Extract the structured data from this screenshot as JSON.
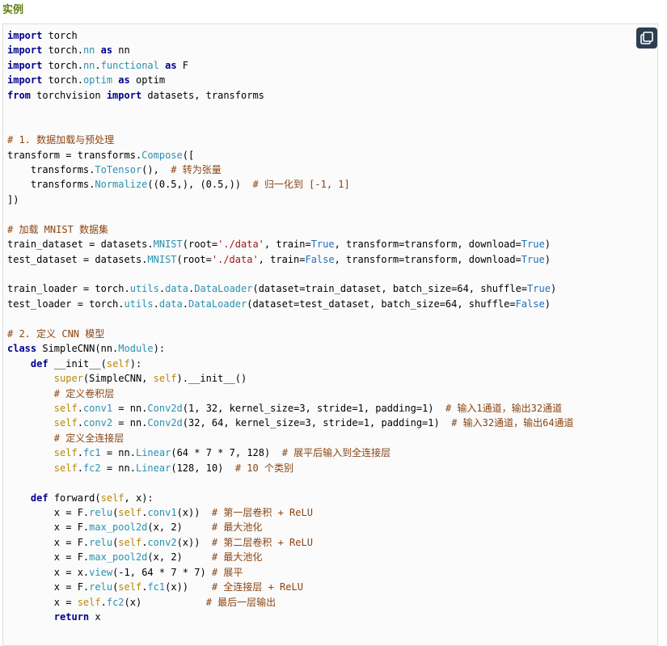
{
  "heading": "实例",
  "copy_button": {
    "icon": "copy-icon",
    "color": "#2d3e50"
  },
  "colors": {
    "heading": "#617f10",
    "keyword": "#00008b",
    "attribute": "#2b91af",
    "string": "#a31515",
    "constant": "#1e6fbf",
    "comment": "#8b4513",
    "self": "#b8860b"
  },
  "code_lines": [
    [
      [
        "kw",
        "import"
      ],
      [
        "plain",
        " torch"
      ]
    ],
    [
      [
        "kw",
        "import"
      ],
      [
        "plain",
        " torch."
      ],
      [
        "attr",
        "nn"
      ],
      [
        "plain",
        " "
      ],
      [
        "kw",
        "as"
      ],
      [
        "plain",
        " nn"
      ]
    ],
    [
      [
        "kw",
        "import"
      ],
      [
        "plain",
        " torch."
      ],
      [
        "attr",
        "nn"
      ],
      [
        "plain",
        "."
      ],
      [
        "attr",
        "functional"
      ],
      [
        "plain",
        " "
      ],
      [
        "kw",
        "as"
      ],
      [
        "plain",
        " F"
      ]
    ],
    [
      [
        "kw",
        "import"
      ],
      [
        "plain",
        " torch."
      ],
      [
        "attr",
        "optim"
      ],
      [
        "plain",
        " "
      ],
      [
        "kw",
        "as"
      ],
      [
        "plain",
        " optim"
      ]
    ],
    [
      [
        "kw",
        "from"
      ],
      [
        "plain",
        " torchvision "
      ],
      [
        "kw",
        "import"
      ],
      [
        "plain",
        " datasets, transforms"
      ]
    ],
    [],
    [],
    [
      [
        "com",
        "# 1. 数据加载与预处理"
      ]
    ],
    [
      [
        "plain",
        "transform = transforms."
      ],
      [
        "attr",
        "Compose"
      ],
      [
        "plain",
        "(["
      ]
    ],
    [
      [
        "plain",
        "    transforms."
      ],
      [
        "attr",
        "ToTensor"
      ],
      [
        "plain",
        "(),  "
      ],
      [
        "com",
        "# 转为张量"
      ]
    ],
    [
      [
        "plain",
        "    transforms."
      ],
      [
        "attr",
        "Normalize"
      ],
      [
        "plain",
        "(("
      ],
      [
        "num",
        "0.5"
      ],
      [
        "plain",
        ",), ("
      ],
      [
        "num",
        "0.5"
      ],
      [
        "plain",
        ",))  "
      ],
      [
        "com",
        "# 归一化到 [-1, 1]"
      ]
    ],
    [
      [
        "plain",
        "])"
      ]
    ],
    [],
    [
      [
        "com",
        "# 加载 MNIST 数据集"
      ]
    ],
    [
      [
        "plain",
        "train_dataset = datasets."
      ],
      [
        "attr",
        "MNIST"
      ],
      [
        "plain",
        "(root="
      ],
      [
        "str",
        "'./data'"
      ],
      [
        "plain",
        ", train="
      ],
      [
        "const",
        "True"
      ],
      [
        "plain",
        ", transform=transform, download="
      ],
      [
        "const",
        "True"
      ],
      [
        "plain",
        ")"
      ]
    ],
    [
      [
        "plain",
        "test_dataset = datasets."
      ],
      [
        "attr",
        "MNIST"
      ],
      [
        "plain",
        "(root="
      ],
      [
        "str",
        "'./data'"
      ],
      [
        "plain",
        ", train="
      ],
      [
        "const",
        "False"
      ],
      [
        "plain",
        ", transform=transform, download="
      ],
      [
        "const",
        "True"
      ],
      [
        "plain",
        ")"
      ]
    ],
    [],
    [
      [
        "plain",
        "train_loader = torch."
      ],
      [
        "attr",
        "utils"
      ],
      [
        "plain",
        "."
      ],
      [
        "attr",
        "data"
      ],
      [
        "plain",
        "."
      ],
      [
        "attr",
        "DataLoader"
      ],
      [
        "plain",
        "(dataset=train_dataset, batch_size="
      ],
      [
        "num",
        "64"
      ],
      [
        "plain",
        ", shuffle="
      ],
      [
        "const",
        "True"
      ],
      [
        "plain",
        ")"
      ]
    ],
    [
      [
        "plain",
        "test_loader = torch."
      ],
      [
        "attr",
        "utils"
      ],
      [
        "plain",
        "."
      ],
      [
        "attr",
        "data"
      ],
      [
        "plain",
        "."
      ],
      [
        "attr",
        "DataLoader"
      ],
      [
        "plain",
        "(dataset=test_dataset, batch_size="
      ],
      [
        "num",
        "64"
      ],
      [
        "plain",
        ", shuffle="
      ],
      [
        "const",
        "False"
      ],
      [
        "plain",
        ")"
      ]
    ],
    [],
    [
      [
        "com",
        "# 2. 定义 CNN 模型"
      ]
    ],
    [
      [
        "kw",
        "class"
      ],
      [
        "plain",
        " SimpleCNN(nn."
      ],
      [
        "attr",
        "Module"
      ],
      [
        "plain",
        "):"
      ]
    ],
    [
      [
        "plain",
        "    "
      ],
      [
        "kw",
        "def"
      ],
      [
        "plain",
        " "
      ],
      [
        "func",
        "__init__"
      ],
      [
        "plain",
        "("
      ],
      [
        "self",
        "self"
      ],
      [
        "plain",
        "):"
      ]
    ],
    [
      [
        "plain",
        "        "
      ],
      [
        "self",
        "super"
      ],
      [
        "plain",
        "(SimpleCNN, "
      ],
      [
        "self",
        "self"
      ],
      [
        "plain",
        ")."
      ],
      [
        "func",
        "__init__"
      ],
      [
        "plain",
        "()"
      ]
    ],
    [
      [
        "plain",
        "        "
      ],
      [
        "com",
        "# 定义卷积层"
      ]
    ],
    [
      [
        "plain",
        "        "
      ],
      [
        "self",
        "self"
      ],
      [
        "plain",
        "."
      ],
      [
        "attr",
        "conv1"
      ],
      [
        "plain",
        " = nn."
      ],
      [
        "attr",
        "Conv2d"
      ],
      [
        "plain",
        "("
      ],
      [
        "num",
        "1"
      ],
      [
        "plain",
        ", "
      ],
      [
        "num",
        "32"
      ],
      [
        "plain",
        ", kernel_size="
      ],
      [
        "num",
        "3"
      ],
      [
        "plain",
        ", stride="
      ],
      [
        "num",
        "1"
      ],
      [
        "plain",
        ", padding="
      ],
      [
        "num",
        "1"
      ],
      [
        "plain",
        ")  "
      ],
      [
        "com",
        "# 输入1通道，输出32通道"
      ]
    ],
    [
      [
        "plain",
        "        "
      ],
      [
        "self",
        "self"
      ],
      [
        "plain",
        "."
      ],
      [
        "attr",
        "conv2"
      ],
      [
        "plain",
        " = nn."
      ],
      [
        "attr",
        "Conv2d"
      ],
      [
        "plain",
        "("
      ],
      [
        "num",
        "32"
      ],
      [
        "plain",
        ", "
      ],
      [
        "num",
        "64"
      ],
      [
        "plain",
        ", kernel_size="
      ],
      [
        "num",
        "3"
      ],
      [
        "plain",
        ", stride="
      ],
      [
        "num",
        "1"
      ],
      [
        "plain",
        ", padding="
      ],
      [
        "num",
        "1"
      ],
      [
        "plain",
        ")  "
      ],
      [
        "com",
        "# 输入32通道，输出64通道"
      ]
    ],
    [
      [
        "plain",
        "        "
      ],
      [
        "com",
        "# 定义全连接层"
      ]
    ],
    [
      [
        "plain",
        "        "
      ],
      [
        "self",
        "self"
      ],
      [
        "plain",
        "."
      ],
      [
        "attr",
        "fc1"
      ],
      [
        "plain",
        " = nn."
      ],
      [
        "attr",
        "Linear"
      ],
      [
        "plain",
        "("
      ],
      [
        "num",
        "64"
      ],
      [
        "plain",
        " * "
      ],
      [
        "num",
        "7"
      ],
      [
        "plain",
        " * "
      ],
      [
        "num",
        "7"
      ],
      [
        "plain",
        ", "
      ],
      [
        "num",
        "128"
      ],
      [
        "plain",
        ")  "
      ],
      [
        "com",
        "# 展平后输入到全连接层"
      ]
    ],
    [
      [
        "plain",
        "        "
      ],
      [
        "self",
        "self"
      ],
      [
        "plain",
        "."
      ],
      [
        "attr",
        "fc2"
      ],
      [
        "plain",
        " = nn."
      ],
      [
        "attr",
        "Linear"
      ],
      [
        "plain",
        "("
      ],
      [
        "num",
        "128"
      ],
      [
        "plain",
        ", "
      ],
      [
        "num",
        "10"
      ],
      [
        "plain",
        ")  "
      ],
      [
        "com",
        "# 10 个类别"
      ]
    ],
    [],
    [
      [
        "plain",
        "    "
      ],
      [
        "kw",
        "def"
      ],
      [
        "plain",
        " forward("
      ],
      [
        "self",
        "self"
      ],
      [
        "plain",
        ", x):"
      ]
    ],
    [
      [
        "plain",
        "        x = F."
      ],
      [
        "attr",
        "relu"
      ],
      [
        "plain",
        "("
      ],
      [
        "self",
        "self"
      ],
      [
        "plain",
        "."
      ],
      [
        "attr",
        "conv1"
      ],
      [
        "plain",
        "(x))  "
      ],
      [
        "com",
        "# 第一层卷积 + ReLU"
      ]
    ],
    [
      [
        "plain",
        "        x = F."
      ],
      [
        "attr",
        "max_pool2d"
      ],
      [
        "plain",
        "(x, "
      ],
      [
        "num",
        "2"
      ],
      [
        "plain",
        ")     "
      ],
      [
        "com",
        "# 最大池化"
      ]
    ],
    [
      [
        "plain",
        "        x = F."
      ],
      [
        "attr",
        "relu"
      ],
      [
        "plain",
        "("
      ],
      [
        "self",
        "self"
      ],
      [
        "plain",
        "."
      ],
      [
        "attr",
        "conv2"
      ],
      [
        "plain",
        "(x))  "
      ],
      [
        "com",
        "# 第二层卷积 + ReLU"
      ]
    ],
    [
      [
        "plain",
        "        x = F."
      ],
      [
        "attr",
        "max_pool2d"
      ],
      [
        "plain",
        "(x, "
      ],
      [
        "num",
        "2"
      ],
      [
        "plain",
        ")     "
      ],
      [
        "com",
        "# 最大池化"
      ]
    ],
    [
      [
        "plain",
        "        x = x."
      ],
      [
        "attr",
        "view"
      ],
      [
        "plain",
        "(-"
      ],
      [
        "num",
        "1"
      ],
      [
        "plain",
        ", "
      ],
      [
        "num",
        "64"
      ],
      [
        "plain",
        " * "
      ],
      [
        "num",
        "7"
      ],
      [
        "plain",
        " * "
      ],
      [
        "num",
        "7"
      ],
      [
        "plain",
        ") "
      ],
      [
        "com",
        "# 展平"
      ]
    ],
    [
      [
        "plain",
        "        x = F."
      ],
      [
        "attr",
        "relu"
      ],
      [
        "plain",
        "("
      ],
      [
        "self",
        "self"
      ],
      [
        "plain",
        "."
      ],
      [
        "attr",
        "fc1"
      ],
      [
        "plain",
        "(x))    "
      ],
      [
        "com",
        "# 全连接层 + ReLU"
      ]
    ],
    [
      [
        "plain",
        "        x = "
      ],
      [
        "self",
        "self"
      ],
      [
        "plain",
        "."
      ],
      [
        "attr",
        "fc2"
      ],
      [
        "plain",
        "(x)           "
      ],
      [
        "com",
        "# 最后一层输出"
      ]
    ],
    [
      [
        "plain",
        "        "
      ],
      [
        "kw",
        "return"
      ],
      [
        "plain",
        " x"
      ]
    ]
  ]
}
